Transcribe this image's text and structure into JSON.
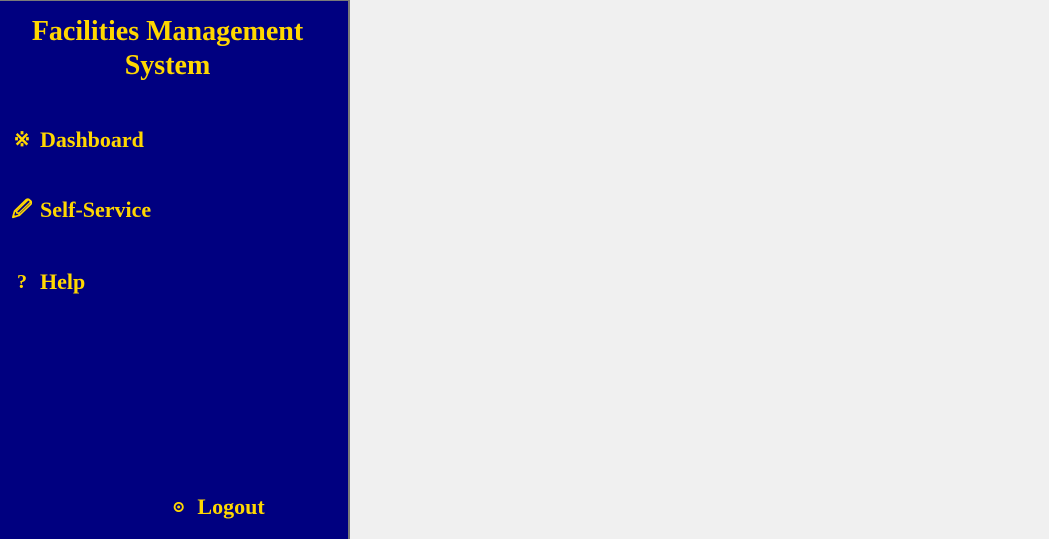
{
  "sidebar": {
    "title": "Facilities Management System",
    "items": [
      {
        "label": "Dashboard",
        "icon": "※"
      },
      {
        "label": "Self-Service",
        "icon": "🖉"
      },
      {
        "label": "Help",
        "icon": "?"
      }
    ],
    "logout": {
      "label": "Logout",
      "icon": "⊙"
    }
  },
  "colors": {
    "sidebar_bg": "#000080",
    "text": "#ffd700",
    "main_bg": "#f0f0f0"
  }
}
